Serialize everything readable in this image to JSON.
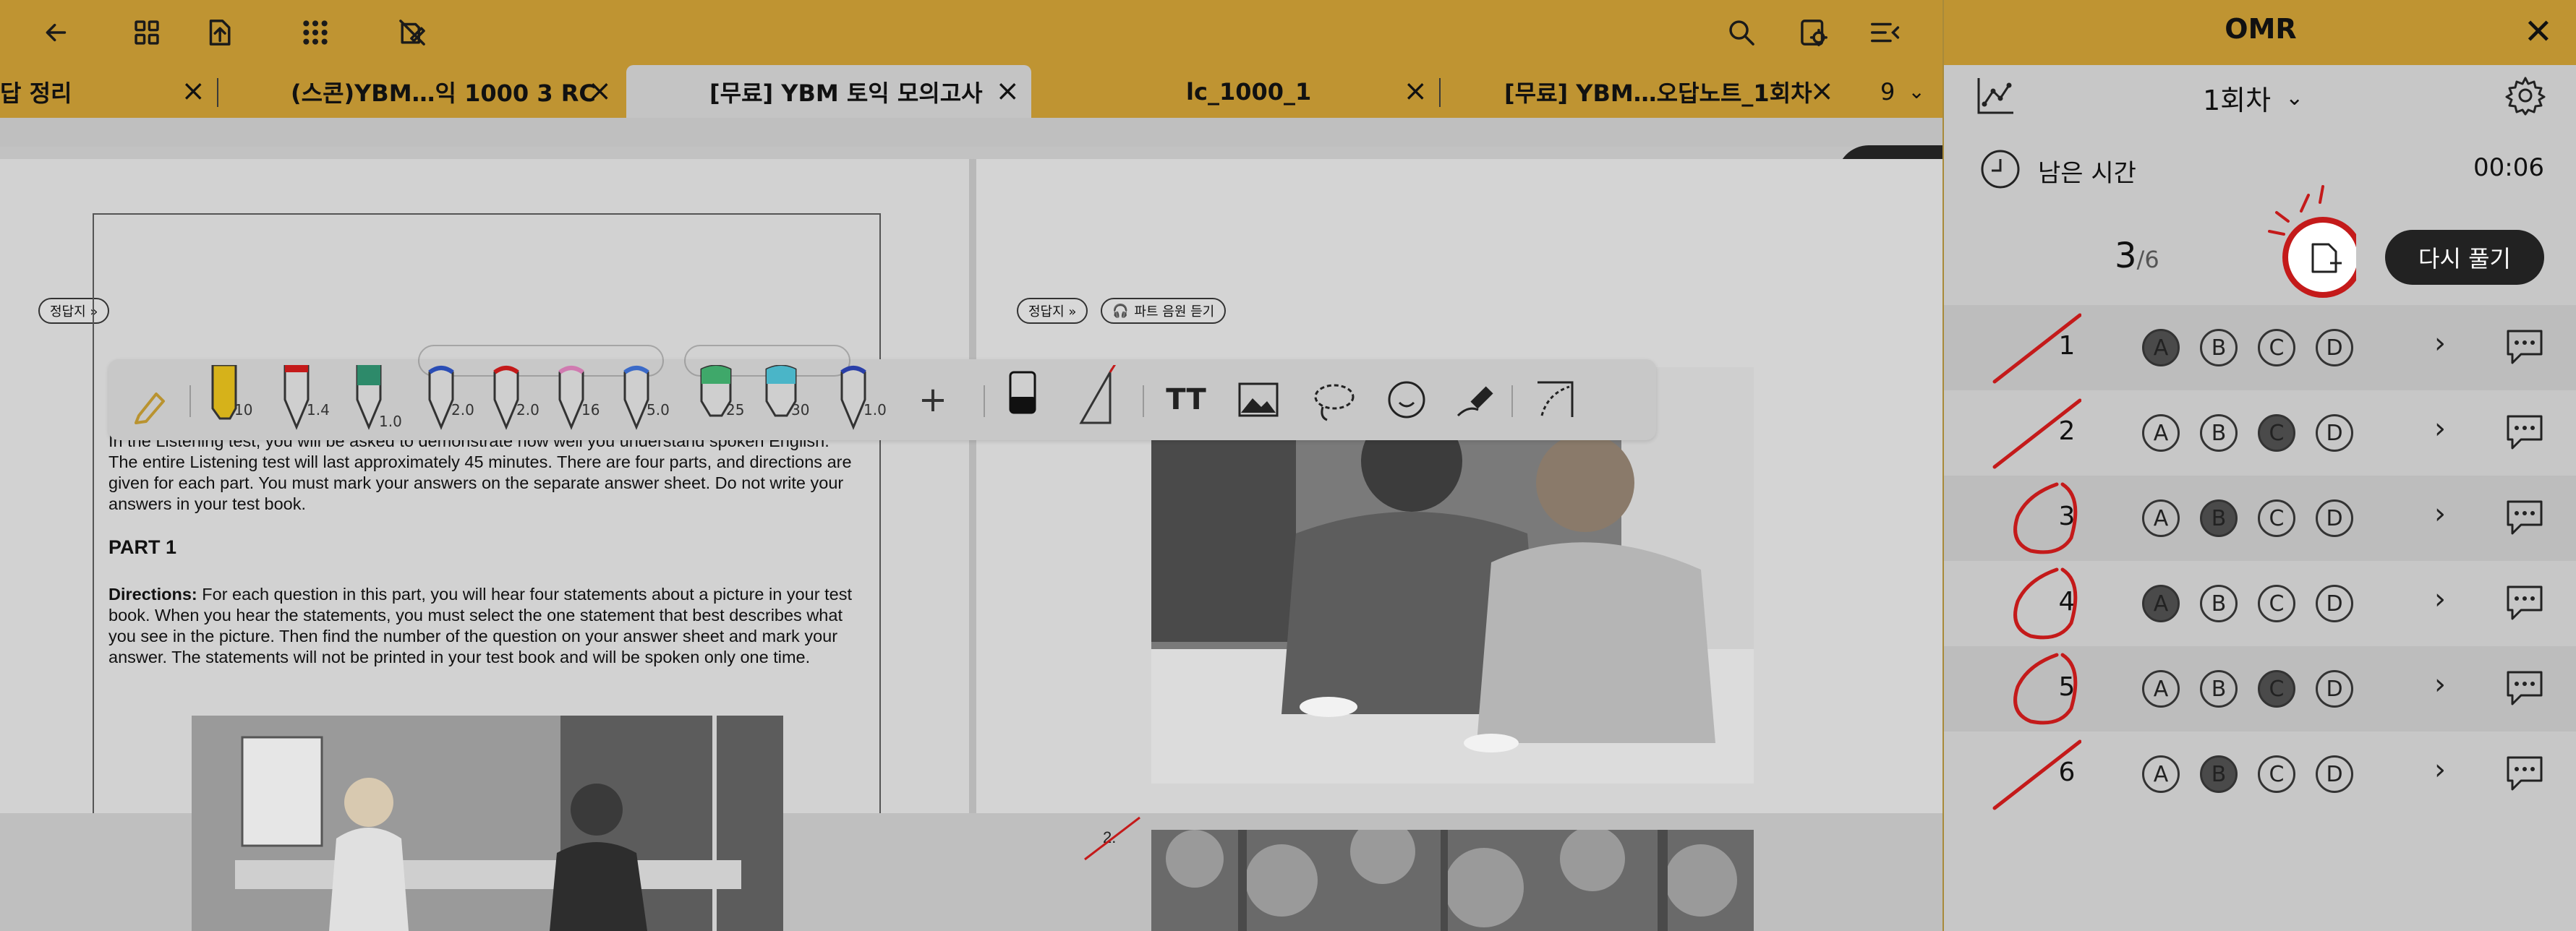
{
  "toolbar": {
    "left_icons": [
      "back-arrow-icon",
      "grid-icon",
      "export-icon",
      "apps-icon",
      "no-edit-icon"
    ],
    "right_icons": [
      "search-icon",
      "settings-page-icon",
      "tab-menu-icon"
    ]
  },
  "tabs": [
    {
      "label": "답 정리",
      "active": false
    },
    {
      "label": "(스콘)YBM…익 1000 3 RC",
      "active": false
    },
    {
      "label": "[무료] YBM 토익 모의고사",
      "active": true
    },
    {
      "label": "lc_1000_1",
      "active": false
    },
    {
      "label": "[무료] YBM…오답노트_1회차",
      "active": false
    }
  ],
  "tab_overflow": {
    "count": "9"
  },
  "document": {
    "omr_button": "OMR",
    "answer_sheet_btn": "정답지 »",
    "answer_sheet_btn2": "정답지 »",
    "audio_btn": "파트 음원 듣기",
    "intro_text": "In the Listening test, you will be asked to demonstrate how well you understand spoken English. The entire Listening test will last approximately 45 minutes. There are four parts, and directions are given for each part. You must mark your answers on the separate answer sheet. Do not write your answers in your test book.",
    "part_heading": "PART 1",
    "directions_label": "Directions:",
    "directions_text": " For each question in this part, you will hear four statements about a picture in your test book. When you hear the statements, you must select the one statement that best describes what you see in the picture. Then find the number of the question on your answer sheet and mark your answer. The statements will not be printed in your test book and will be spoken only one time.",
    "question_2_label": "2."
  },
  "pen_toolbar": {
    "sizes": [
      "10",
      "1.4",
      "1.0",
      "2.0",
      "2.0",
      "16",
      "5.0",
      "25",
      "30",
      "1.0"
    ],
    "add_label": "+",
    "text_tool_label": "TT"
  },
  "omr_panel": {
    "title": "OMR",
    "session": "1회차",
    "remaining_label": "남은 시간",
    "remaining_time": "00:06",
    "progress_current": "3",
    "progress_total": "/6",
    "retry_button": "다시 풀기",
    "questions": [
      {
        "num": "1",
        "choices": [
          "A",
          "B",
          "C",
          "D"
        ],
        "selected": "A",
        "mark": "wrong"
      },
      {
        "num": "2",
        "choices": [
          "A",
          "B",
          "C",
          "D"
        ],
        "selected": "C",
        "mark": "wrong"
      },
      {
        "num": "3",
        "choices": [
          "A",
          "B",
          "C",
          "D"
        ],
        "selected": "B",
        "mark": "correct"
      },
      {
        "num": "4",
        "choices": [
          "A",
          "B",
          "C",
          "D"
        ],
        "selected": "A",
        "mark": "correct"
      },
      {
        "num": "5",
        "choices": [
          "A",
          "B",
          "C",
          "D"
        ],
        "selected": "C",
        "mark": "correct"
      },
      {
        "num": "6",
        "choices": [
          "A",
          "B",
          "C",
          "D"
        ],
        "selected": "B",
        "mark": "wrong"
      }
    ]
  },
  "colors": {
    "accent": "#bf9432",
    "mark_red": "#c41a1a",
    "pill_dark": "#222222"
  }
}
